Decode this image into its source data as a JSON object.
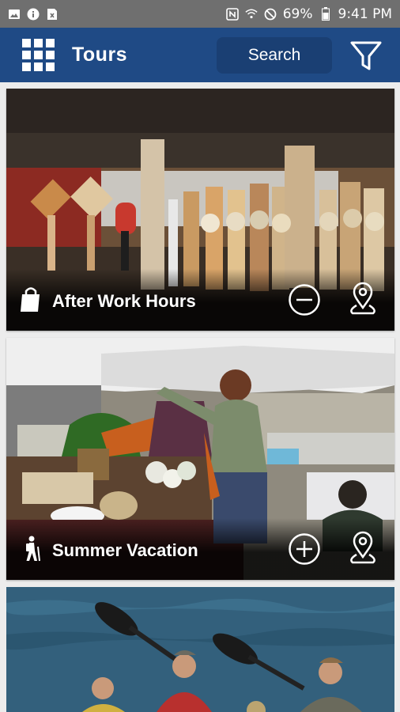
{
  "status_bar": {
    "battery": "69%",
    "time": "9:41 PM",
    "icons": [
      "image-icon",
      "info-icon",
      "sim-x-icon",
      "nfc-icon",
      "wifi-question-icon",
      "do-not-disturb-icon",
      "battery-icon"
    ]
  },
  "app_bar": {
    "title": "Tours",
    "search_label": "Search",
    "menu_icon": "grid-icon",
    "filter_icon": "filter-icon"
  },
  "tours": [
    {
      "title": "After Work Hours",
      "category_icon": "shopping-bag-icon",
      "action": "remove",
      "action_icon": "minus-circle-icon",
      "map_icon": "map-pin-icon"
    },
    {
      "title": "Summer Vacation",
      "category_icon": "hiker-icon",
      "action": "add",
      "action_icon": "plus-circle-icon",
      "map_icon": "map-pin-icon"
    },
    {
      "title": "",
      "category_icon": "",
      "action": "",
      "action_icon": "",
      "map_icon": ""
    }
  ],
  "colors": {
    "app_bar": "#1f4a85",
    "status_bar": "#6f6f6f",
    "background": "#ececec"
  }
}
